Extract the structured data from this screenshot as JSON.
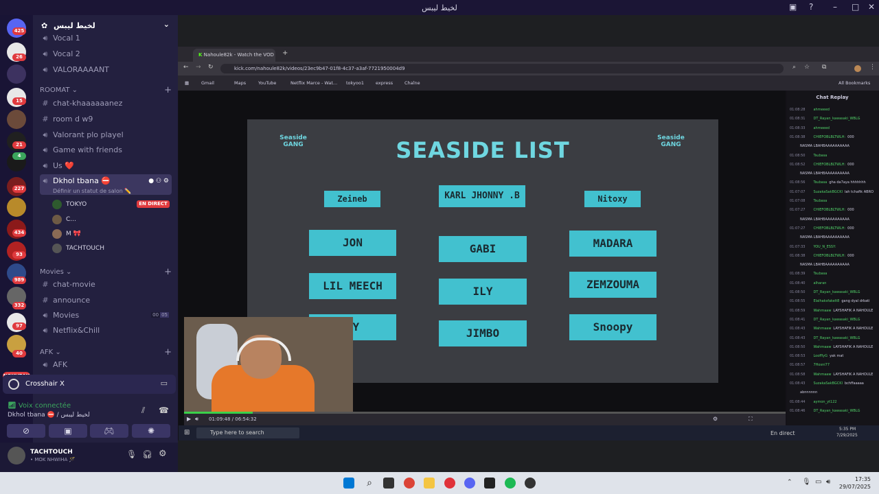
{
  "window": {
    "title": "لخيط ليبس"
  },
  "servers": {
    "badges": [
      "425",
      "26",
      "15",
      "21",
      "4",
      "227",
      "434",
      "93",
      "989",
      "332",
      "97",
      "40"
    ],
    "new_label": "NOUVEAU"
  },
  "server": {
    "name": "لخيط ليبس"
  },
  "channels": {
    "top": [
      "Vocal 1",
      "Vocal 2",
      "VALORAAAANT"
    ],
    "roomat_label": "ROOMAT",
    "roomat": [
      "chat-khaaaaaanez",
      "room d w9",
      "Valorant plo playel",
      "Game with friends",
      "Us ❤️"
    ],
    "active_voice": "Dkhol tbana ⛔",
    "active_sub": "Définir un statut de salon ✏️",
    "members": [
      "TOKYO",
      "C...",
      "M 🎀",
      "TACHTOUCH"
    ],
    "live_label": "EN DIRECT",
    "movies_label": "Movies",
    "movies": [
      "chat-movie",
      "announce",
      "Movies",
      "Netflix&Chill"
    ],
    "movies_counts": [
      "00",
      "05"
    ],
    "afk_label": "AFK",
    "afk": [
      "AFK"
    ]
  },
  "activity": {
    "title": "Crosshair X"
  },
  "voice": {
    "status": "Voix connectée",
    "channel": "Dkhol tbana ⛔ / لخيط ليبس"
  },
  "user": {
    "name": "TACHTOUCH",
    "status": "• MOK NHWIHA 🪄"
  },
  "browser": {
    "tab_title": "Nahoule82k - Watch the VOD :",
    "url": "kick.com/nahoule82k/videos/23ec9b47-01f8-4c37-a3af-7721950004d9",
    "bookmarks": [
      "Gmail",
      "Maps",
      "YouTube",
      "Netflix Marce - Wat...",
      "tokyoo1",
      "express",
      "Chaîne"
    ],
    "all_bookmarks": "All Bookmarks"
  },
  "list": {
    "title": "SEASIDE LIST",
    "logo": "Seaside GANG",
    "col1": [
      "Zeineb",
      "JON",
      "LIL MEECH",
      "AY"
    ],
    "col2": [
      "KARL JHONNY .B",
      "GABI",
      "ILY",
      "JIMBO"
    ],
    "col3": [
      "Nitoxy",
      "MADARA",
      "ZEMZOUMA",
      "Snoopy"
    ]
  },
  "player": {
    "time": "01:09:48 / 06:54:32"
  },
  "inner_taskbar": {
    "search": "Type here to search",
    "live": "En direct",
    "time": "5:35 PM",
    "date": "7/29/2025"
  },
  "chat": {
    "title": "Chat Replay",
    "messages": [
      {
        "time": "01:08:28",
        "user": "ahmeeed",
        "text": ""
      },
      {
        "time": "01:08:31",
        "user": "DT_Rayan_kawasaki_WBLG",
        "text": ""
      },
      {
        "time": "01:08:33",
        "user": "ahmeeed",
        "text": ""
      },
      {
        "time": "01:08:38",
        "user": "CHIEFOBLBLTWLH:",
        "text": "000"
      },
      {
        "time": "",
        "user": "",
        "text": "NASMA LBAHBAAAAAAAAAA"
      },
      {
        "time": "01:08:50",
        "user": "Tsubasa",
        "text": ""
      },
      {
        "time": "01:08:52",
        "user": "CHIEFOBLBLTWLH:",
        "text": "000"
      },
      {
        "time": "",
        "user": "",
        "text": "NASMA LBAHBAAAAAAAAAA"
      },
      {
        "time": "01:08:56",
        "user": "Tsubasa",
        "text": "gha da7aya hhhhhhh"
      },
      {
        "time": "01:07:07",
        "user": "SuzakaSakBGCKI",
        "text": "lah tchafik ABRO"
      },
      {
        "time": "01:07:08",
        "user": "Tsubasa",
        "text": ""
      },
      {
        "time": "01:07:27",
        "user": "CHIEFOBLBLTWLH:",
        "text": "000"
      },
      {
        "time": "",
        "user": "",
        "text": "NASMA LBAHBAAAAAAAAAA"
      },
      {
        "time": "01:07:27",
        "user": "CHIEFOBLBLTWLH:",
        "text": "000"
      },
      {
        "time": "",
        "user": "",
        "text": "NASMA LBAHBAAAAAAAAAA"
      },
      {
        "time": "01:07:33",
        "user": "YOU_N_ESSY:",
        "text": ""
      },
      {
        "time": "01:08:38",
        "user": "CHIEFOBLBLTWLH:",
        "text": "000"
      },
      {
        "time": "",
        "user": "",
        "text": "NASMA LBAHBAAAAAAAAAA"
      },
      {
        "time": "01:08:39",
        "user": "Tsubasa",
        "text": ""
      },
      {
        "time": "01:08:40",
        "user": "alharan",
        "text": ""
      },
      {
        "time": "01:08:50",
        "user": "DT_Rayan_kawasaki_WBLG",
        "text": ""
      },
      {
        "time": "01:08:55",
        "user": "Elalhaksfakelt8",
        "text": "gang dyal drbati"
      },
      {
        "time": "01:08:59",
        "user": "Wahmaaw",
        "text": "LAYSHAFIK A NAHOULE"
      },
      {
        "time": "01:08:41",
        "user": "DT_Rayan_kawasaki_WBLG",
        "text": ""
      },
      {
        "time": "01:08:43",
        "user": "Wahmaaw",
        "text": "LAYSHAFIK A NAHOULE"
      },
      {
        "time": "01:08:43",
        "user": "DT_Rayan_kawasaki_WBLG",
        "text": ""
      },
      {
        "time": "01:08:50",
        "user": "Wahmaaw",
        "text": "LAYSHAFIK A NAHOULE"
      },
      {
        "time": "01:08:53",
        "user": "LoofflyG",
        "text": "yak mat"
      },
      {
        "time": "01:08:57",
        "user": "7Hosni77",
        "text": ""
      },
      {
        "time": "01:08:58",
        "user": "Wahmaaw",
        "text": "LAYSHAFIK A NAHOULE"
      },
      {
        "time": "01:08:43",
        "user": "SuzakaSakBGCKI",
        "text": "bchffaaaaa"
      },
      {
        "time": "",
        "user": "",
        "text": "abnnnnnn"
      },
      {
        "time": "01:08:44",
        "user": "aymon_yt122",
        "text": ""
      },
      {
        "time": "01:08:46",
        "user": "DT_Rayan_kawasaki_WBLG",
        "text": ""
      }
    ]
  },
  "taskbar": {
    "time": "17:35",
    "date": "29/07/2025"
  },
  "colors": {
    "accent": "#42c1cf",
    "live": "#e03a3e",
    "discord_bg": "#23203f"
  }
}
